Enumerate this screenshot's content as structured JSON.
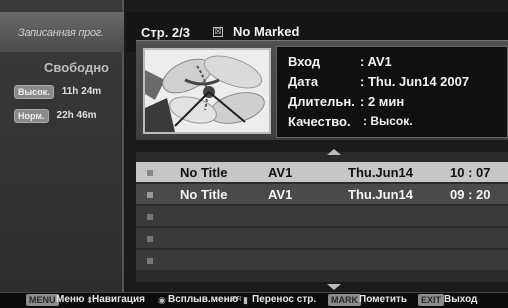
{
  "left": {
    "title": "Записанная прог.",
    "free_label": "Свободно",
    "quality": [
      {
        "badge": "Высок.",
        "time": "11h 24m"
      },
      {
        "badge": "Норм.",
        "time": "22h 46m"
      }
    ]
  },
  "header": {
    "page": "Стр. 2/3",
    "marked": "No Marked"
  },
  "info": {
    "labels": [
      "Вход",
      "Дата",
      "Длительн.",
      "Качество."
    ],
    "values": [
      ": AV1",
      ": Thu. Jun14 2007",
      ": 2 мин",
      ": Высок."
    ]
  },
  "list": {
    "rows": [
      {
        "title": "No Title",
        "input": "AV1",
        "date": "Thu.Jun14",
        "time": "10 : 07"
      },
      {
        "title": "No Title",
        "input": "AV1",
        "date": "Thu.Jun14",
        "time": "09 : 20"
      }
    ]
  },
  "footer": {
    "menu_key": "MENU",
    "menu_text": "Меню",
    "nav_text": "Навигация",
    "popup_text": "Всплыв.меню",
    "pr_key": "PR",
    "page_text": "Перенос стр.",
    "mark_key": "MARK",
    "mark_text": "Пометить",
    "exit_key": "EXIT",
    "exit_text": "Выход"
  },
  "colors": {
    "selected_row": "#c6c6c6",
    "normal_row": "#4a4a4a",
    "background": "#1b1b1b"
  }
}
